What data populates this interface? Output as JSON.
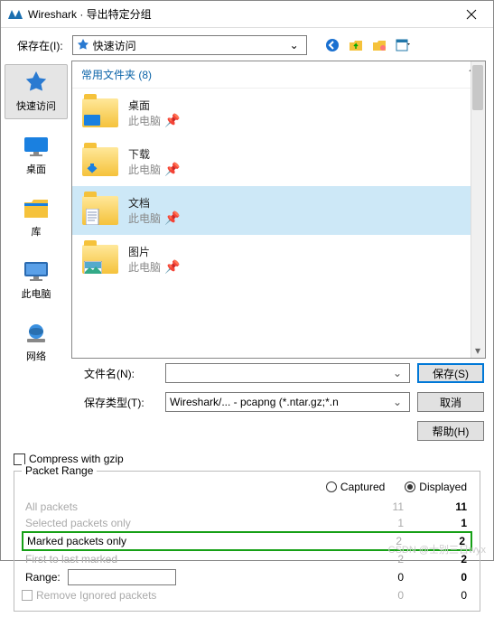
{
  "window": {
    "title": "Wireshark · 导出特定分组"
  },
  "savein": {
    "label": "保存在(I):",
    "value": "快速访问"
  },
  "places": [
    {
      "id": "quick",
      "label": "快速访问"
    },
    {
      "id": "desktop",
      "label": "桌面"
    },
    {
      "id": "libraries",
      "label": "库"
    },
    {
      "id": "thispc",
      "label": "此电脑"
    },
    {
      "id": "network",
      "label": "网络"
    }
  ],
  "listHeader": "常用文件夹 (8)",
  "items": [
    {
      "name": "桌面",
      "sub": "此电脑",
      "kind": "desktop"
    },
    {
      "name": "下载",
      "sub": "此电脑",
      "kind": "downloads"
    },
    {
      "name": "文档",
      "sub": "此电脑",
      "kind": "documents",
      "selected": true
    },
    {
      "name": "图片",
      "sub": "此电脑",
      "kind": "pictures"
    }
  ],
  "fields": {
    "filename_label": "文件名(N):",
    "filename_value": "",
    "type_label": "保存类型(T):",
    "type_value": "Wireshark/... - pcapng (*.ntar.gz;*.n"
  },
  "buttons": {
    "save": "保存(S)",
    "cancel": "取消",
    "help": "帮助(H)"
  },
  "compress_label": "Compress with gzip",
  "range": {
    "legend": "Packet Range",
    "captured": "Captured",
    "displayed": "Displayed",
    "rows": {
      "all": {
        "label": "All packets",
        "c": "11",
        "d": "11"
      },
      "selected": {
        "label": "Selected packets only",
        "c": "1",
        "d": "1"
      },
      "marked": {
        "label": "Marked packets only",
        "c": "2",
        "d": "2"
      },
      "first": {
        "label": "First to last marked",
        "c": "2",
        "d": "2"
      },
      "range": {
        "label": "Range:",
        "c": "0",
        "d": "0"
      },
      "remove": {
        "label": "Remove Ignored packets",
        "c": "0",
        "d": "0"
      }
    }
  },
  "watermark": "CSDN @士别三日wyx"
}
